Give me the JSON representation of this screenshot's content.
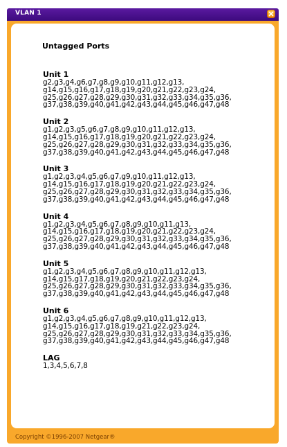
{
  "window": {
    "title": "VLAN 1",
    "close_icon": "close-icon"
  },
  "panel": {
    "heading": "Untagged Ports"
  },
  "units": [
    {
      "label": "Unit 1",
      "ports": "g2,g3,g4,g6,g7,g8,g9,g10,g11,g12,g13,\ng14,g15,g16,g17,g18,g19,g20,g21,g22,g23,g24,\ng25,g26,g27,g28,g29,g30,g31,g32,g33,g34,g35,g36,\ng37,g38,g39,g40,g41,g42,g43,g44,g45,g46,g47,g48"
    },
    {
      "label": "Unit 2",
      "ports": "g1,g2,g3,g5,g6,g7,g8,g9,g10,g11,g12,g13,\ng14,g15,g16,g17,g18,g19,g20,g21,g22,g23,g24,\ng25,g26,g27,g28,g29,g30,g31,g32,g33,g34,g35,g36,\ng37,g38,g39,g40,g41,g42,g43,g44,g45,g46,g47,g48"
    },
    {
      "label": "Unit 3",
      "ports": "g1,g2,g3,g4,g5,g6,g7,g9,g10,g11,g12,g13,\ng14,g15,g16,g17,g18,g19,g20,g21,g22,g23,g24,\ng25,g26,g27,g28,g29,g30,g31,g32,g33,g34,g35,g36,\ng37,g38,g39,g40,g41,g42,g43,g44,g45,g46,g47,g48"
    },
    {
      "label": "Unit 4",
      "ports": "g1,g2,g3,g4,g5,g6,g7,g8,g9,g10,g11,g13,\ng14,g15,g16,g17,g18,g19,g20,g21,g22,g23,g24,\ng25,g26,g27,g28,g29,g30,g31,g32,g33,g34,g35,g36,\ng37,g38,g39,g40,g41,g42,g43,g44,g45,g46,g47,g48"
    },
    {
      "label": "Unit 5",
      "ports": "g1,g2,g3,g4,g5,g6,g7,g8,g9,g10,g11,g12,g13,\ng14,g15,g17,g18,g19,g20,g21,g22,g23,g24,\ng25,g26,g27,g28,g29,g30,g31,g32,g33,g34,g35,g36,\ng37,g38,g39,g40,g41,g42,g43,g44,g45,g46,g47,g48"
    },
    {
      "label": "Unit 6",
      "ports": "g1,g2,g3,g4,g5,g6,g7,g8,g9,g10,g11,g12,g13,\ng14,g15,g16,g17,g18,g19,g21,g22,g23,g24,\ng25,g26,g27,g28,g29,g30,g31,g32,g33,g34,g35,g36,\ng37,g38,g39,g40,g41,g42,g43,g44,g45,g46,g47,g48"
    },
    {
      "label": "LAG",
      "ports": "1,3,4,5,6,7,8"
    }
  ],
  "footer": {
    "copyright": "Copyright ©1996-2007 Netgear®"
  },
  "colors": {
    "titlebar": "#4b1290",
    "frame": "#f9a82b",
    "close_button": "#f39a1c"
  }
}
